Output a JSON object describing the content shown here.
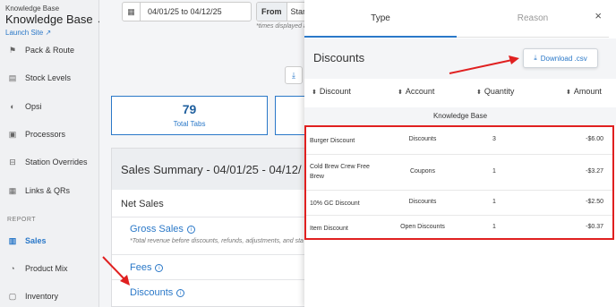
{
  "sidebar": {
    "brand_small": "Knowledge Base",
    "brand": "Knowledge Base",
    "launch": "Launch Site",
    "items": [
      {
        "label": "Pack & Route",
        "icon": "route-icon"
      },
      {
        "label": "Stock Levels",
        "icon": "stock-icon"
      },
      {
        "label": "Opsi",
        "icon": "opsi-icon"
      },
      {
        "label": "Processors",
        "icon": "processor-icon"
      },
      {
        "label": "Station Overrides",
        "icon": "station-icon"
      },
      {
        "label": "Links & QRs",
        "icon": "qr-icon"
      }
    ],
    "report_label": "REPORT",
    "report_items": [
      {
        "label": "Sales",
        "icon": "sales-icon",
        "active": true
      },
      {
        "label": "Product Mix",
        "icon": "product-mix-icon"
      },
      {
        "label": "Inventory",
        "icon": "inventory-icon"
      }
    ]
  },
  "main": {
    "date_range": "04/01/25 to 04/12/25",
    "from_label": "From",
    "from_value": "Star",
    "tz_note": "*times displayed a",
    "tabs_value": "79",
    "tabs_label": "Total Tabs",
    "summary_title": "Sales Summary - 04/01/25 - 04/12/",
    "net_sales": "Net Sales",
    "gross_sales": "Gross Sales",
    "gross_note": "*Total revenue before discounts, refunds, adjustments, and sta",
    "fees": "Fees",
    "discounts": "Discounts"
  },
  "panel": {
    "tab_type": "Type",
    "tab_reason": "Reason",
    "close": "×",
    "title": "Discounts",
    "download": "Download .csv",
    "columns": [
      "Discount",
      "Account",
      "Quantity",
      "Amount"
    ],
    "group": "Knowledge Base",
    "rows": [
      {
        "discount": "Burger Discount",
        "account": "Discounts",
        "quantity": "3",
        "amount": "-$6.00"
      },
      {
        "discount": "Cold Brew Crew Free Brew",
        "account": "Coupons",
        "quantity": "1",
        "amount": "-$3.27"
      },
      {
        "discount": "10% GC Discount",
        "account": "Discounts",
        "quantity": "1",
        "amount": "-$2.50"
      },
      {
        "discount": "Item Discount",
        "account": "Open Discounts",
        "quantity": "1",
        "amount": "-$0.37"
      }
    ]
  },
  "colors": {
    "accent": "#2a78c8",
    "highlight": "#e02020"
  }
}
